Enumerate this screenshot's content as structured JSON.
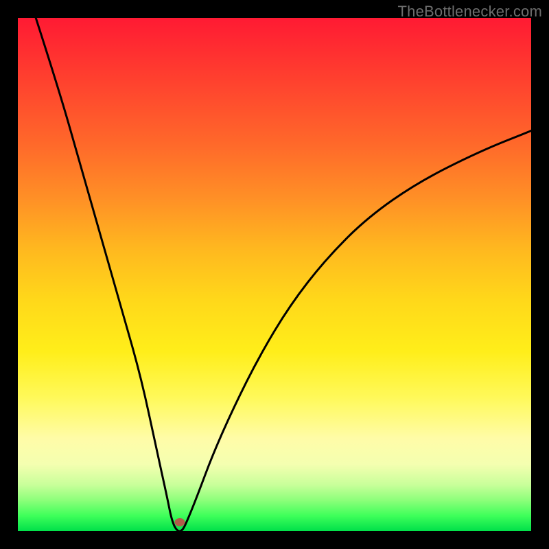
{
  "watermark": "TheBottlenecker.com",
  "colors": {
    "frame": "#000000",
    "marker": "#b35a4a",
    "curve": "#000000"
  },
  "chart_data": {
    "type": "line",
    "title": "",
    "xlabel": "",
    "ylabel": "",
    "xlim": [
      0,
      100
    ],
    "ylim": [
      0,
      100
    ],
    "series": [
      {
        "name": "bottleneck-curve",
        "x": [
          3.5,
          8,
          12,
          16,
          20,
          24,
          27,
          29,
          30,
          31,
          32,
          33,
          35,
          38,
          42,
          47,
          53,
          60,
          68,
          78,
          90,
          100
        ],
        "values": [
          100,
          86,
          72,
          58,
          44,
          30,
          16,
          7,
          2,
          0,
          0,
          2,
          7,
          15,
          24,
          34,
          44,
          53,
          61,
          68,
          74,
          78
        ]
      }
    ],
    "marker": {
      "x_pct": 31.5,
      "y_from_top_pct": 98.2
    },
    "gradient_stops": [
      {
        "pct": 0,
        "color": "#ff1a33"
      },
      {
        "pct": 25,
        "color": "#ff6a2a"
      },
      {
        "pct": 55,
        "color": "#ffd81a"
      },
      {
        "pct": 82,
        "color": "#fffca8"
      },
      {
        "pct": 97,
        "color": "#3eff5a"
      },
      {
        "pct": 100,
        "color": "#00e04a"
      }
    ]
  }
}
